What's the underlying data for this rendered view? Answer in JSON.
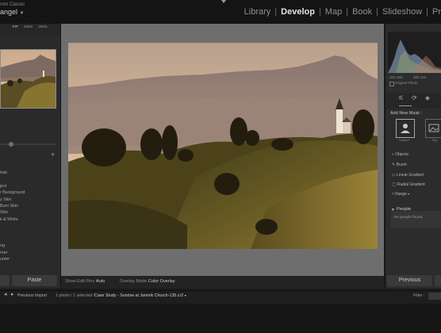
{
  "app": {
    "brand_line1": "rom Classic",
    "brand_line2": "angel",
    "brand_arrow": "▼"
  },
  "modules": [
    "Library",
    "Develop",
    "Map",
    "Book",
    "Slideshow",
    "Pr"
  ],
  "active_module": "Develop",
  "navigator": {
    "zoom_options": [
      "FIT",
      "100%",
      "200%"
    ]
  },
  "left_panel": {
    "presets": [
      "trait",
      "",
      "ject",
      "r Background",
      "y Skin",
      "Burn Skin",
      "Skin",
      "k & White",
      "",
      "",
      "",
      "ng",
      "rner",
      "unter"
    ],
    "paste_label": "Paste"
  },
  "center": {
    "show_edit_pins_label": "Show Edit Pins :",
    "show_edit_pins_value": "Auto",
    "overlay_mode_label": "Overlay Mode :",
    "overlay_mode_value": "Color Overlay"
  },
  "right_panel": {
    "histogram_left": "ISO 200",
    "histogram_right": "300 mm",
    "original_photo_label": "Original Photo",
    "add_new_mask_label": "Add New Mask :",
    "mask_subject_label": "Subject",
    "mask_sky_label": "Sky",
    "mask_tools": [
      "Objects",
      "Brush",
      "Linear Gradient",
      "Radial Gradient",
      "Range"
    ],
    "people_title": "People",
    "people_message": "No people found.",
    "previous_label": "Previous"
  },
  "filmstrip_bar": {
    "previous_import": "Previous Import",
    "count_text": "1 photo / 1 selected /",
    "file_name": "Case Study - Sunrise at Jamnik Church-135.cr2",
    "filter_label": "Filter :"
  },
  "colors": {
    "accent_active": "#e2e2e2",
    "panel_bg": "#2a2a2a",
    "workspace_bg": "#6e6e6e"
  }
}
